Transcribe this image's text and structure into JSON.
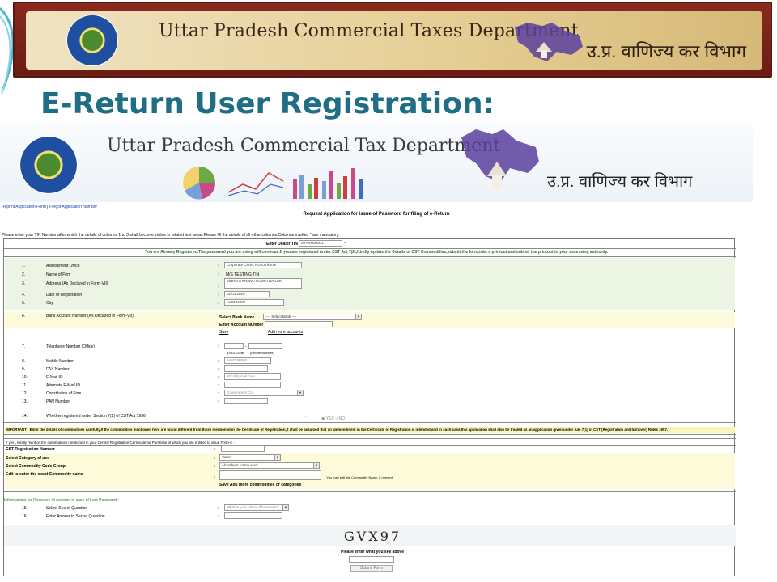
{
  "top_banner": {
    "title": "Uttar Pradesh Commercial Taxes Department",
    "hindi_title": "उ.प्र. वाणिज्य कर विभाग"
  },
  "slide_heading": "E-Return User Registration:",
  "inner_banner": {
    "title": "Uttar Pradesh Commercial Tax Department",
    "hindi_title": "उ.प्र. वाणिज्य कर विभाग"
  },
  "links": {
    "reprint": "Reprint Application Form",
    "separator": "|",
    "forgot": "Forgot Application Number"
  },
  "form": {
    "request_title": "Request Application for issue of Password for filing of e-Return",
    "intro_note": "Please enter your TIN Number after which the details of columns 1 to 3 shall become visible in related text areas.Please fill the details of all other columns.Columns marked * are mandatory.",
    "dealer_tin_label": "Enter Dealer TIN :",
    "dealer_tin_value": "09700000001",
    "registered_notice": "You are Already Registered.The password you are using will continue.If you are registered under CST Act 7(2),Kindly update the Details of CST Commodities,submit the form,take a printout and submit the printout to your assessing authority.",
    "rows": [
      {
        "num": "1.",
        "label": "Assessment Office",
        "value": "Corporate Circle, HO Lucknow"
      },
      {
        "num": "2.",
        "label": "Name of Firm",
        "value": "M/S TESTING TIN"
      },
      {
        "num": "3.",
        "label": "Address (As Declared in Form-VII)",
        "value": "VIBHUTI KHAND GOMTI NAGAR"
      },
      {
        "num": "4.",
        "label": "Date of Registration",
        "value": "01/01/2010"
      },
      {
        "num": "5.",
        "label": "City",
        "value": "LUCKNOW"
      }
    ],
    "bank": {
      "num": "6.",
      "label": "Bank Account Number (As Declared in Form-VII)",
      "select_bank_label": "Select Bank Name",
      "select_bank_value": "---- Select Bank ----",
      "account_label": "Enter Account Number :",
      "save_link": "Save",
      "add_more_link": "Add more accounts"
    },
    "phone": {
      "num": "7.",
      "label": "Telephone Number (Office)",
      "std_hint": "(STD Code)",
      "phone_hint": "(Phone Number)"
    },
    "contact_rows": [
      {
        "num": "8.",
        "label": "Mobile Number",
        "value": "9450398688"
      },
      {
        "num": "9.",
        "label": "FAX Number",
        "value": ""
      },
      {
        "num": "10.",
        "label": "E-Mail ID",
        "value": "abcd@gmail.com"
      },
      {
        "num": "11.",
        "label": "Alternate E-Mail ID",
        "value": ""
      },
      {
        "num": "12.",
        "label": "Constitution of Firm",
        "value": "Government Co."
      },
      {
        "num": "13.",
        "label": "PAN Number",
        "value": ""
      }
    ],
    "cst": {
      "num": "14.",
      "label": "Whether registered under Section 7(2) of CST Act 1956",
      "yes": "YES",
      "no": "NO"
    },
    "important_note": "IMPORTANT : Enter the details of commodities carefully.If the commodities mentioned here are found different from those mentioned in the Certificate of Registration,it shall be assumed that an ammendment in the Certificate of Registration is intended and in such case,this application shall also be treated as an application given under rule 7(1) of CST (Registration and turnover) Rules 1957.",
    "yes_note": "If yes , Kindly mention the commodities mentioned in your Central Registration Certificate for Purchase of which you are entitled to issue Form-C :",
    "cst_reg_label": "CST Registration Number",
    "category_label": "Select Category of use",
    "category_value": "Select",
    "group_label": "Select Commodity Code Group",
    "group_value": "Absorbent cotton wool.",
    "commodity_label": "Edit to enter the exact Commodity name",
    "commodity_hint": "( You may edit the Commodity Name, if needed)",
    "save_add_link": "Save Add more commodities or categories",
    "recovery_title": "Informations for Recovery of Account in case of Lost Password :",
    "q15": {
      "num": "15.",
      "label": "Select Secret Question",
      "value": "What is your place of business?"
    },
    "q16": {
      "num": "16.",
      "label": "Enter Answer to Secret Question",
      "value": ""
    },
    "captcha": "GVX97",
    "captcha_prompt": "Please enter what you see above",
    "submit": "Submit Form"
  },
  "colors": {
    "heading": "#1f6e85",
    "banner_frame": "#7a2418",
    "notice_green": "#1d7a1d",
    "link_blue": "#1c3fb0",
    "band_yellow": "#fdfbd9"
  }
}
